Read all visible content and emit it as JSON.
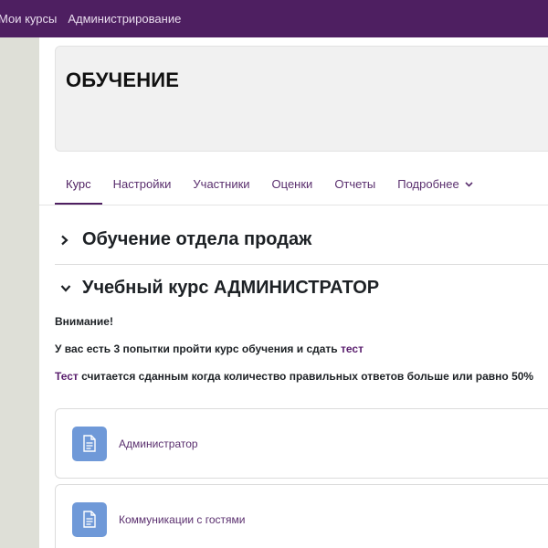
{
  "navbar": {
    "links": [
      "Мои курсы",
      "Администрирование"
    ],
    "color": "#4e1f61"
  },
  "page": {
    "title": "ОБУЧЕНИЕ"
  },
  "tabs": [
    {
      "label": "Курс",
      "active": true
    },
    {
      "label": "Настройки",
      "active": false
    },
    {
      "label": "Участники",
      "active": false
    },
    {
      "label": "Оценки",
      "active": false
    },
    {
      "label": "Отчеты",
      "active": false
    },
    {
      "label": "Подробнее",
      "active": false,
      "has_dropdown": true
    }
  ],
  "sections": [
    {
      "title": "Обучение отдела продаж",
      "expanded": false
    },
    {
      "title": "Учебный курс АДМИНИСТРАТОР",
      "expanded": true
    }
  ],
  "notice": {
    "heading": "Внимание!",
    "line1_text": "У вас есть 3 попытки пройти курс обучения и сдать ",
    "line1_link": "тест",
    "line2_link": "Тест",
    "line2_text": " считается сданным когда количество правильных ответов больше или равно 50%"
  },
  "activities": [
    {
      "label": "Администратор",
      "icon": "page-icon"
    },
    {
      "label": "Коммуникации с гостями",
      "icon": "page-icon"
    }
  ],
  "colors": {
    "accent": "#4e1f61",
    "link": "#5a2f6e",
    "activity_icon_bg": "#6f99d8"
  }
}
